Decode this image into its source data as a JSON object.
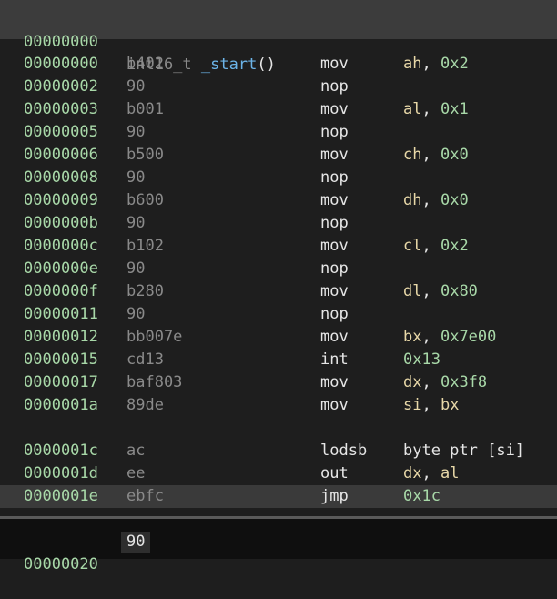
{
  "function_header": {
    "address": "00000000",
    "return_type": "int16_t",
    "name": "_start",
    "parens": "()"
  },
  "instructions": [
    {
      "addr": "00000000",
      "bytes": "b402",
      "mnemonic": "mov",
      "operands": [
        {
          "t": "ah",
          "k": "reg"
        },
        {
          "t": ", ",
          "k": "plain"
        },
        {
          "t": "0x2",
          "k": "num"
        }
      ]
    },
    {
      "addr": "00000002",
      "bytes": "90",
      "mnemonic": "nop",
      "operands": []
    },
    {
      "addr": "00000003",
      "bytes": "b001",
      "mnemonic": "mov",
      "operands": [
        {
          "t": "al",
          "k": "reg"
        },
        {
          "t": ", ",
          "k": "plain"
        },
        {
          "t": "0x1",
          "k": "num"
        }
      ]
    },
    {
      "addr": "00000005",
      "bytes": "90",
      "mnemonic": "nop",
      "operands": []
    },
    {
      "addr": "00000006",
      "bytes": "b500",
      "mnemonic": "mov",
      "operands": [
        {
          "t": "ch",
          "k": "reg"
        },
        {
          "t": ", ",
          "k": "plain"
        },
        {
          "t": "0x0",
          "k": "num"
        }
      ]
    },
    {
      "addr": "00000008",
      "bytes": "90",
      "mnemonic": "nop",
      "operands": []
    },
    {
      "addr": "00000009",
      "bytes": "b600",
      "mnemonic": "mov",
      "operands": [
        {
          "t": "dh",
          "k": "reg"
        },
        {
          "t": ", ",
          "k": "plain"
        },
        {
          "t": "0x0",
          "k": "num"
        }
      ]
    },
    {
      "addr": "0000000b",
      "bytes": "90",
      "mnemonic": "nop",
      "operands": []
    },
    {
      "addr": "0000000c",
      "bytes": "b102",
      "mnemonic": "mov",
      "operands": [
        {
          "t": "cl",
          "k": "reg"
        },
        {
          "t": ", ",
          "k": "plain"
        },
        {
          "t": "0x2",
          "k": "num"
        }
      ]
    },
    {
      "addr": "0000000e",
      "bytes": "90",
      "mnemonic": "nop",
      "operands": []
    },
    {
      "addr": "0000000f",
      "bytes": "b280",
      "mnemonic": "mov",
      "operands": [
        {
          "t": "dl",
          "k": "reg"
        },
        {
          "t": ", ",
          "k": "plain"
        },
        {
          "t": "0x80",
          "k": "num"
        }
      ]
    },
    {
      "addr": "00000011",
      "bytes": "90",
      "mnemonic": "nop",
      "operands": []
    },
    {
      "addr": "00000012",
      "bytes": "bb007e",
      "mnemonic": "mov",
      "operands": [
        {
          "t": "bx",
          "k": "reg"
        },
        {
          "t": ", ",
          "k": "plain"
        },
        {
          "t": "0x7e00",
          "k": "num"
        }
      ]
    },
    {
      "addr": "00000015",
      "bytes": "cd13",
      "mnemonic": "int",
      "operands": [
        {
          "t": "0x13",
          "k": "num"
        }
      ]
    },
    {
      "addr": "00000017",
      "bytes": "baf803",
      "mnemonic": "mov",
      "operands": [
        {
          "t": "dx",
          "k": "reg"
        },
        {
          "t": ", ",
          "k": "plain"
        },
        {
          "t": "0x3f8",
          "k": "num"
        }
      ]
    },
    {
      "addr": "0000001a",
      "bytes": "89de",
      "mnemonic": "mov",
      "operands": [
        {
          "t": "si",
          "k": "reg"
        },
        {
          "t": ", ",
          "k": "plain"
        },
        {
          "t": "bx",
          "k": "reg"
        }
      ]
    },
    {
      "gap": true
    },
    {
      "addr": "0000001c",
      "bytes": "ac",
      "mnemonic": "lodsb",
      "operands": [
        {
          "t": "byte ptr [si]",
          "k": "plain"
        }
      ]
    },
    {
      "addr": "0000001d",
      "bytes": "ee",
      "mnemonic": "out",
      "operands": [
        {
          "t": "dx",
          "k": "reg"
        },
        {
          "t": ", ",
          "k": "plain"
        },
        {
          "t": "al",
          "k": "reg"
        }
      ]
    },
    {
      "addr": "0000001e",
      "bytes": "ebfc",
      "mnemonic": "jmp",
      "operands": [
        {
          "t": "0x1c",
          "k": "num"
        }
      ],
      "highlight": true
    }
  ],
  "bottom_row": {
    "addr": "00000020",
    "byte": "90"
  }
}
